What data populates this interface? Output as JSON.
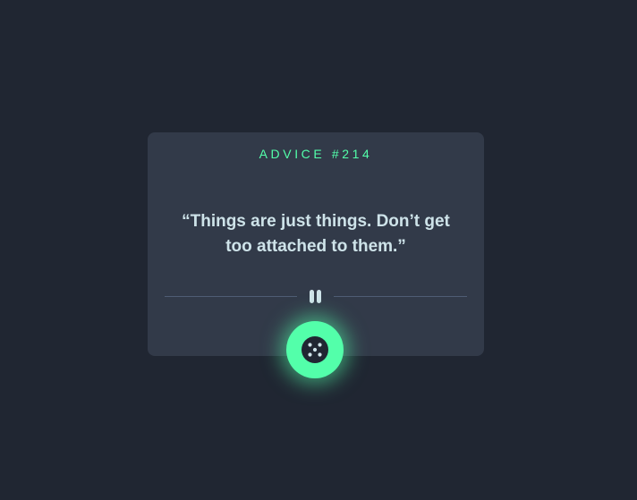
{
  "card": {
    "advice_label": "ADVICE #214",
    "quote": "“Things are just things. Don’t get too attached to them.”"
  },
  "icons": {
    "divider": "pause-icon",
    "button": "dice-icon"
  },
  "colors": {
    "background": "#202632",
    "card": "#323a49",
    "accent": "#53ffaa",
    "text": "#cee3e9",
    "divider": "#4f5d74"
  }
}
